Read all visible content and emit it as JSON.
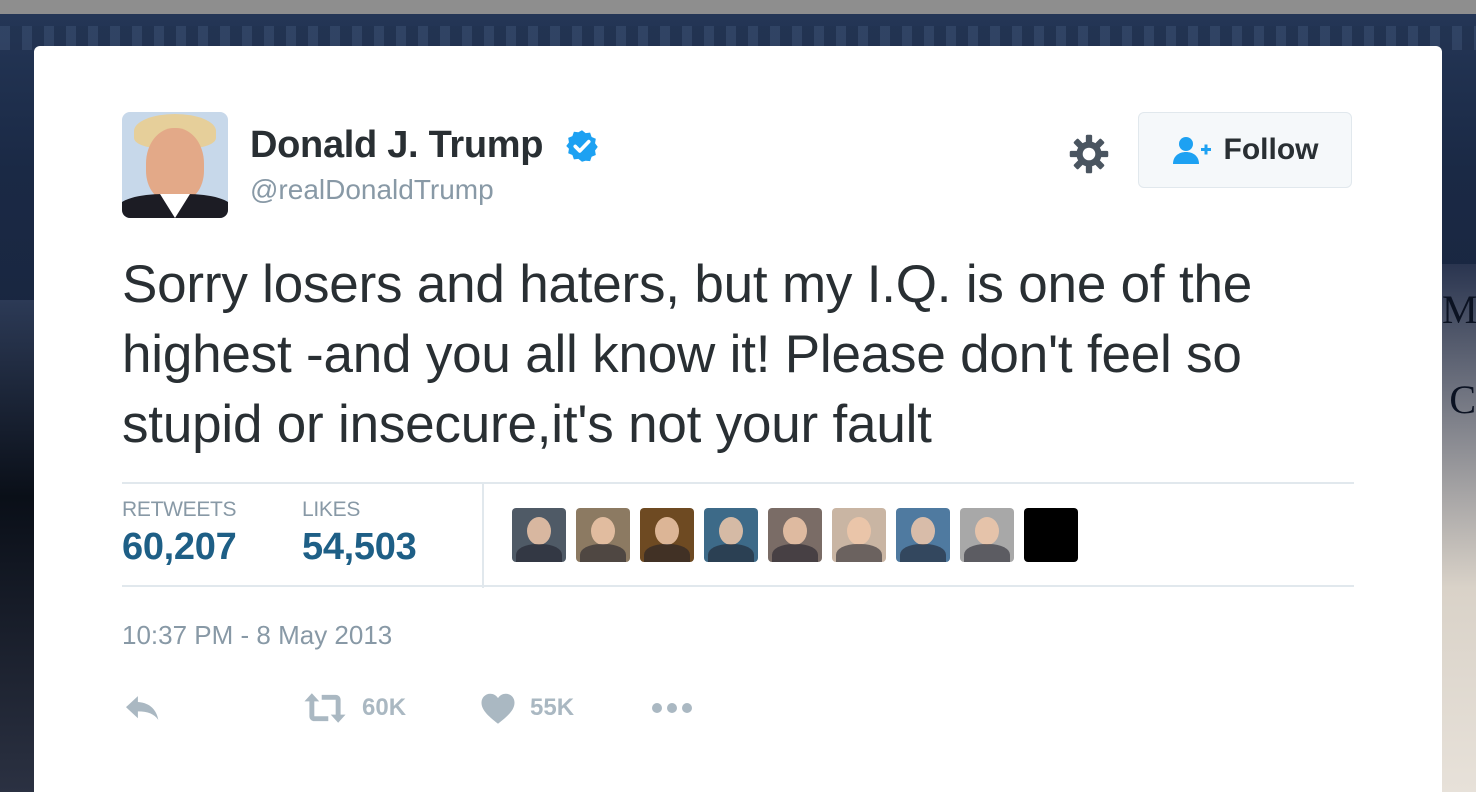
{
  "profile": {
    "name": "Donald J. Trump",
    "handle": "@realDonaldTrump",
    "verified": true
  },
  "follow_button": {
    "label": "Follow"
  },
  "tweet": {
    "text": "Sorry losers and haters, but my I.Q. is one of the highest -and you all know it! Please don't feel so stupid or insecure,it's not your fault",
    "timestamp": "10:37 PM - 8 May 2013"
  },
  "stats": {
    "retweets_label": "RETWEETS",
    "retweets_value": "60,207",
    "likes_label": "LIKES",
    "likes_value": "54,503"
  },
  "likers": [
    {
      "color": "#4f5a66"
    },
    {
      "color": "#8c7a62"
    },
    {
      "color": "#6e4a22"
    },
    {
      "color": "#3d6a88"
    },
    {
      "color": "#7a6c66"
    },
    {
      "color": "#c9b5a3"
    },
    {
      "color": "#4f7aa0"
    },
    {
      "color": "#a8a8a8"
    },
    {
      "color": "#000000"
    }
  ],
  "actions": {
    "retweet_count": "60K",
    "like_count": "55K"
  },
  "colors": {
    "verified_blue": "#1da1f2",
    "follow_icon_blue": "#1da1f2",
    "stat_value_blue": "#1e5f86",
    "muted_gray": "#8899a6",
    "text_dark": "#292f33"
  }
}
